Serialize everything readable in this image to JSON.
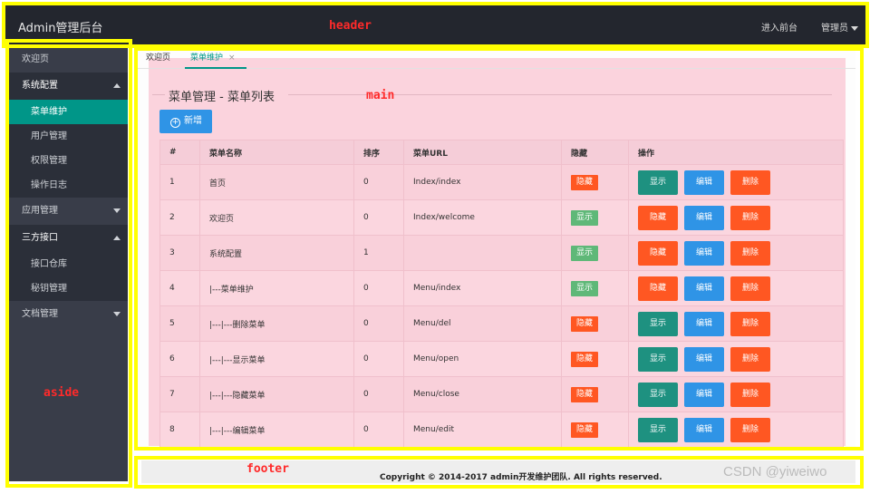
{
  "header": {
    "logo": "Admin管理后台",
    "tag": "header",
    "front_link": "进入前台",
    "admin_link": "管理员"
  },
  "aside": {
    "tag": "aside",
    "items": [
      {
        "label": "欢迎页",
        "type": "item"
      },
      {
        "label": "系统配置",
        "type": "group-open"
      },
      {
        "label": "菜单维护",
        "type": "child-active"
      },
      {
        "label": "用户管理",
        "type": "child"
      },
      {
        "label": "权限管理",
        "type": "child"
      },
      {
        "label": "操作日志",
        "type": "child"
      },
      {
        "label": "应用管理",
        "type": "group-closed"
      },
      {
        "label": "三方接口",
        "type": "group-open"
      },
      {
        "label": "接口仓库",
        "type": "child"
      },
      {
        "label": "秘钥管理",
        "type": "child"
      },
      {
        "label": "文档管理",
        "type": "group-closed"
      }
    ]
  },
  "main": {
    "tag": "main",
    "tabs": {
      "home": "欢迎页",
      "active": "菜单维护",
      "close": "×"
    },
    "legend": "菜单管理 - 菜单列表",
    "add_button": "新增",
    "table": {
      "headers": [
        "#",
        "菜单名称",
        "排序",
        "菜单URL",
        "隐藏",
        "操作"
      ],
      "rows": [
        {
          "id": "1",
          "name": "首页",
          "sort": "0",
          "url": "Index/index",
          "hidden": true
        },
        {
          "id": "2",
          "name": "欢迎页",
          "sort": "0",
          "url": "Index/welcome",
          "hidden": false
        },
        {
          "id": "3",
          "name": "系统配置",
          "sort": "1",
          "url": "",
          "hidden": false
        },
        {
          "id": "4",
          "name": "|---菜单维护",
          "sort": "0",
          "url": "Menu/index",
          "hidden": false
        },
        {
          "id": "5",
          "name": "|---|---删除菜单",
          "sort": "0",
          "url": "Menu/del",
          "hidden": true
        },
        {
          "id": "6",
          "name": "|---|---显示菜单",
          "sort": "0",
          "url": "Menu/open",
          "hidden": true
        },
        {
          "id": "7",
          "name": "|---|---隐藏菜单",
          "sort": "0",
          "url": "Menu/close",
          "hidden": true
        },
        {
          "id": "8",
          "name": "|---|---编辑菜单",
          "sort": "0",
          "url": "Menu/edit",
          "hidden": true
        }
      ],
      "badge_hidden": "隐藏",
      "badge_shown": "显示",
      "op_show": "显示",
      "op_hide": "隐藏",
      "op_edit": "编辑",
      "op_delete": "删除"
    }
  },
  "footer": {
    "tag": "footer",
    "copyright": "Copyright © 2014-2017 admin开发维护团队. All rights reserved."
  },
  "watermark": "CSDN @yiweiwo",
  "colors": {
    "header_bg": "#23262e",
    "aside_bg": "#393d49",
    "active": "#009688",
    "primary_blue": "#2f94e6",
    "danger": "#ff5722",
    "success": "#5fb878",
    "highlight": "#ffff00",
    "label_red": "#ff2a2a",
    "main_bg": "#fbd3dd"
  }
}
